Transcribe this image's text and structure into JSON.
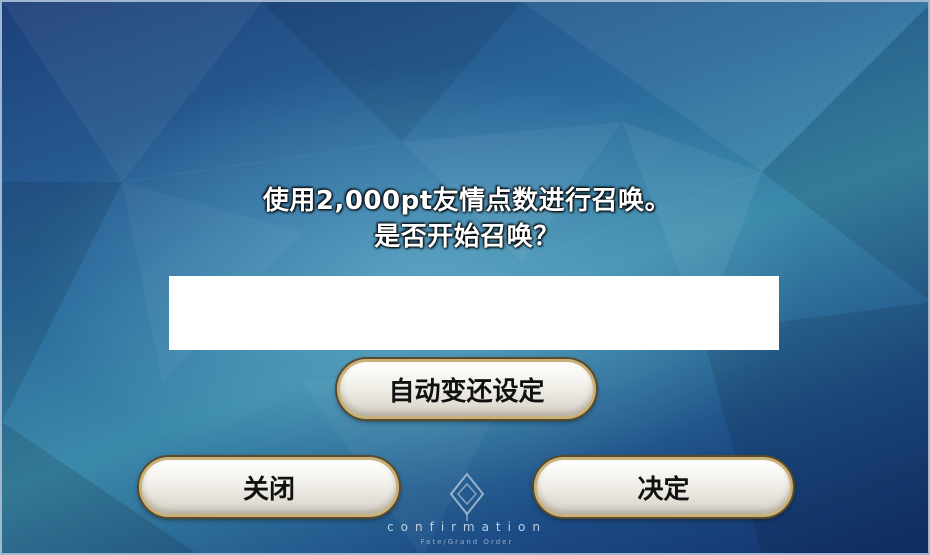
{
  "dialog": {
    "message_line1": "使用2,000pt友情点数进行召唤。",
    "message_line2": "是否开始召唤？"
  },
  "buttons": {
    "auto_convert": "自动变还设定",
    "close": "关闭",
    "confirm": "决定"
  },
  "footer": {
    "caption": "confirmation",
    "subcaption": "Fate/Grand Order",
    "emblem_icon": "fgo-emblem-icon"
  },
  "colors": {
    "background_top": "#1d3f7a",
    "background_mid": "#3b8aaa",
    "button_border": "#c8b27a"
  }
}
